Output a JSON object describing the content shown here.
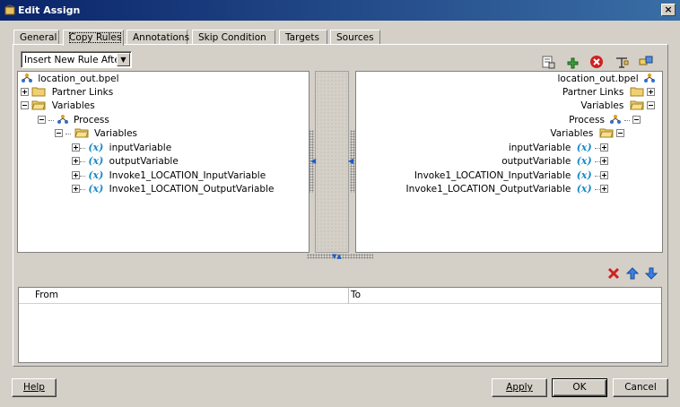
{
  "window": {
    "title": "Edit Assign",
    "close_label": "×"
  },
  "tabs": [
    {
      "label": "General"
    },
    {
      "label": "Copy Rules"
    },
    {
      "label": "Annotations"
    },
    {
      "label": "Skip Condition"
    },
    {
      "label": "Targets"
    },
    {
      "label": "Sources"
    }
  ],
  "active_tab": "Copy Rules",
  "rule_dropdown": {
    "value": "Insert New Rule After",
    "arrow": "▼"
  },
  "toolbar_icons": [
    "xpath-expression-icon",
    "add-rule-icon",
    "delete-icon",
    "literal-icon",
    "bind-entity-icon"
  ],
  "source_tree": {
    "root": "location_out.bpel",
    "partner_links": "Partner Links",
    "variables": "Variables",
    "process": "Process",
    "process_variables": "Variables",
    "items": [
      "inputVariable",
      "outputVariable",
      "Invoke1_LOCATION_InputVariable",
      "Invoke1_LOCATION_OutputVariable"
    ],
    "var_glyph": "(x)"
  },
  "target_tree": {
    "root": "location_out.bpel",
    "partner_links": "Partner Links",
    "variables": "Variables",
    "process": "Process",
    "process_variables": "Variables",
    "items": [
      "inputVariable",
      "outputVariable",
      "Invoke1_LOCATION_InputVariable",
      "Invoke1_LOCATION_OutputVariable"
    ],
    "var_glyph": "(x)"
  },
  "rules_table": {
    "columns": [
      "From",
      "To"
    ]
  },
  "buttons": {
    "help": "Help",
    "apply": "Apply",
    "ok": "OK",
    "cancel": "Cancel"
  },
  "colors": {
    "title_bar": "#0a246a",
    "var_icon": "#1a8ac8",
    "delete_red": "#d02020",
    "arrow_blue": "#1a5cc8"
  }
}
